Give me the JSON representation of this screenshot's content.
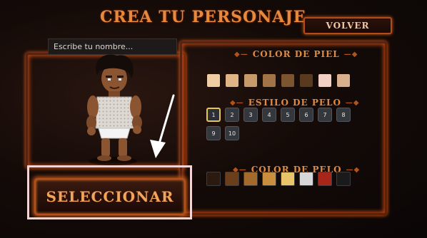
{
  "title": "CREA TU PERSONAJE",
  "back_button": "VOLVER",
  "name_input": {
    "placeholder": "Escribe tu nombre...",
    "value": ""
  },
  "skin_section": {
    "label": "COLOR DE PIEL",
    "colors": [
      "#f1cda3",
      "#dfb487",
      "#c79a6a",
      "#a27347",
      "#7c5430",
      "#5a3a1f",
      "#f3d0c5",
      "#d8b08e"
    ]
  },
  "hair_style_section": {
    "label": "ESTILO DE PELO",
    "options": [
      "1",
      "2",
      "3",
      "4",
      "5",
      "6",
      "7",
      "8",
      "9",
      "10"
    ],
    "selected": "1"
  },
  "hair_color_section": {
    "label": "COLOR DE PELO",
    "colors": [
      "#2a1a10",
      "#6b3f1a",
      "#a26b2c",
      "#c98f3e",
      "#e9c46a",
      "#d7d7d7",
      "#a8251a",
      "#1a1a1d"
    ]
  },
  "select_button": "SELECCIONAR"
}
